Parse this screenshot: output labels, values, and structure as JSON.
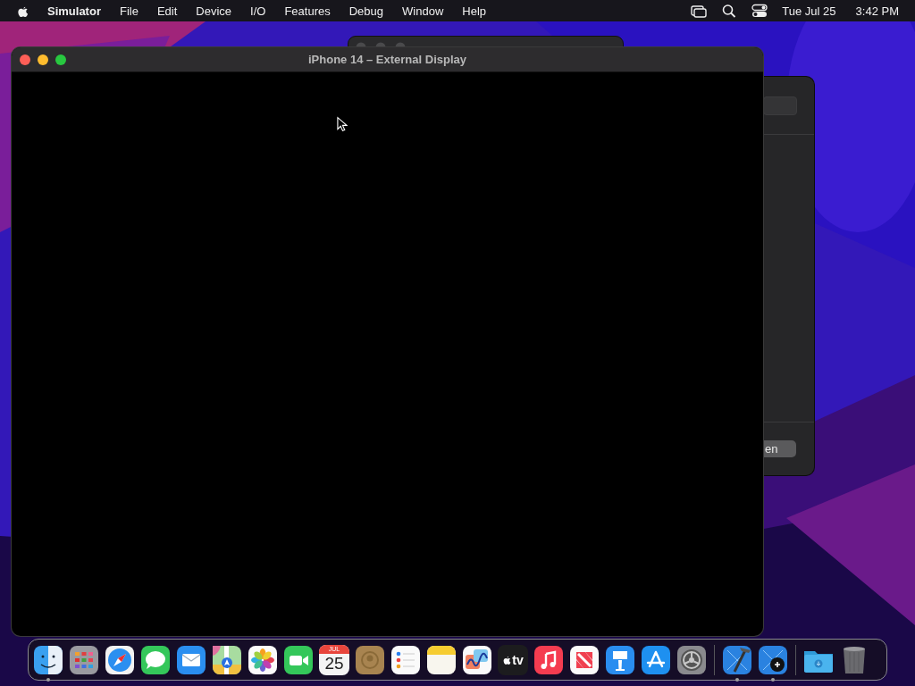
{
  "menu_bar": {
    "items": [
      {
        "label": "Simulator",
        "kind": "app"
      },
      {
        "label": "File",
        "kind": "menu"
      },
      {
        "label": "Edit",
        "kind": "menu"
      },
      {
        "label": "Device",
        "kind": "menu"
      },
      {
        "label": "I/O",
        "kind": "menu"
      },
      {
        "label": "Features",
        "kind": "menu"
      },
      {
        "label": "Debug",
        "kind": "menu"
      },
      {
        "label": "Window",
        "kind": "menu"
      },
      {
        "label": "Help",
        "kind": "menu"
      }
    ],
    "date": "Tue Jul 25",
    "time": "3:42 PM"
  },
  "front_window": {
    "title": "iPhone 14 – External Display"
  },
  "side_window": {
    "button": "en"
  },
  "dock": {
    "items": [
      {
        "kind": "finder",
        "running": true
      },
      {
        "kind": "launchpad",
        "running": false
      },
      {
        "kind": "safari",
        "running": false
      },
      {
        "kind": "messages",
        "running": false
      },
      {
        "kind": "mail",
        "running": false
      },
      {
        "kind": "maps",
        "running": false
      },
      {
        "kind": "photos",
        "running": false
      },
      {
        "kind": "facetime",
        "running": false
      },
      {
        "kind": "calendar",
        "running": false,
        "month": "JUL",
        "day": "25"
      },
      {
        "kind": "contacts",
        "running": false
      },
      {
        "kind": "reminders",
        "running": false
      },
      {
        "kind": "notes",
        "running": false
      },
      {
        "kind": "freeform",
        "running": false
      },
      {
        "kind": "tv",
        "running": false,
        "label": "tv"
      },
      {
        "kind": "music",
        "running": false
      },
      {
        "kind": "news",
        "running": false
      },
      {
        "kind": "keynote",
        "running": false
      },
      {
        "kind": "appstore",
        "running": false
      },
      {
        "kind": "settings",
        "running": false
      },
      {
        "kind": "separator"
      },
      {
        "kind": "xcode",
        "running": true
      },
      {
        "kind": "instruments",
        "running": true
      },
      {
        "kind": "separator"
      },
      {
        "kind": "downloads",
        "running": false
      },
      {
        "kind": "trash",
        "running": false
      }
    ]
  }
}
